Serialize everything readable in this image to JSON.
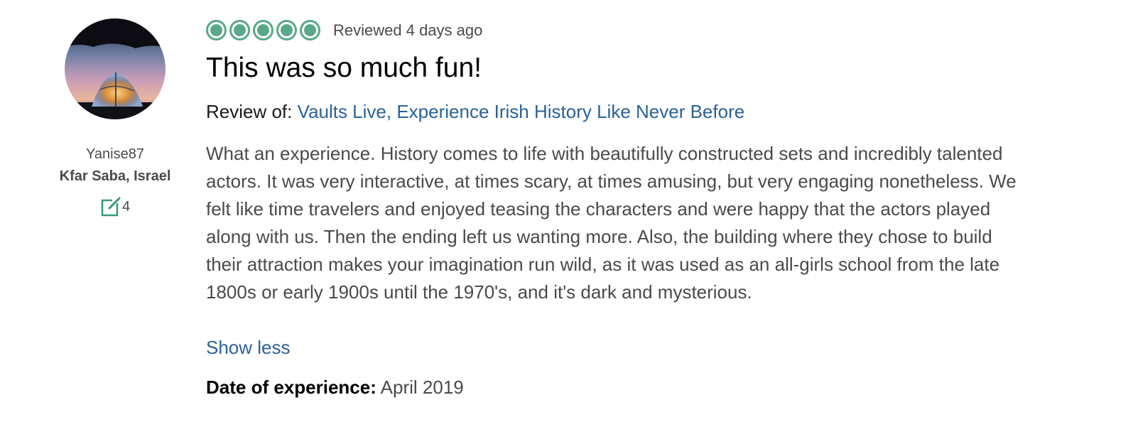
{
  "reviewer": {
    "username": "Yanise87",
    "location": "Kfar Saba, Israel",
    "contributions": "4",
    "contribution_icon": "review-edit-icon"
  },
  "review": {
    "rating": 5,
    "rating_max": 5,
    "reviewed_date": "Reviewed 4 days ago",
    "title": "This was so much fun!",
    "review_of_label": "Review of:",
    "review_of_link": "Vaults Live, Experience Irish History Like Never Before",
    "body": "What an experience. History comes to life with beautifully constructed sets and incredibly talented actors. It was very interactive, at times scary, at times amusing, but very engaging nonetheless. We felt like time travelers and enjoyed teasing the characters and were happy that the actors played along with us. Then the ending left us wanting more. Also, the building where they chose to build their attraction makes your imagination run wild, as it was used as an all-girls school from the late 1800s or early 1900s until the 1970's, and it's dark and mysterious.",
    "show_less": "Show less",
    "date_of_experience_label": "Date of experience:",
    "date_of_experience_value": "April 2019"
  },
  "colors": {
    "bubble_green": "#5aa88a",
    "link_blue": "#2a6296",
    "text_gray": "#4a4a4a"
  }
}
